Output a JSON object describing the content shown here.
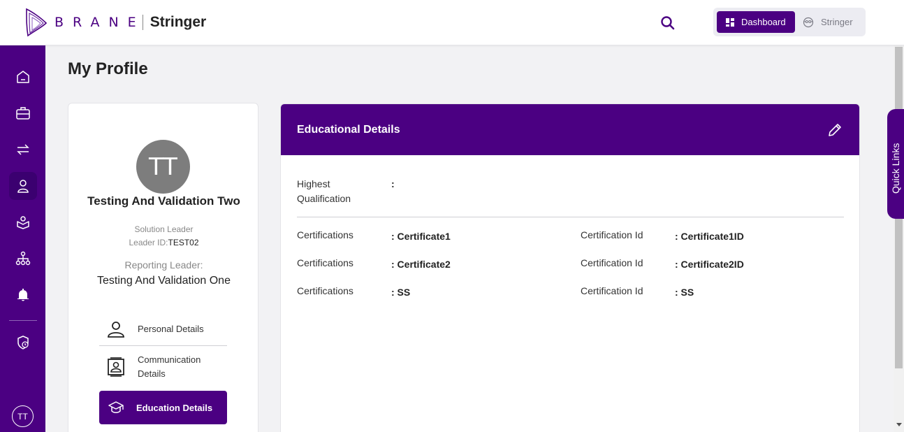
{
  "header": {
    "brand": "BRANE",
    "product": "Stringer",
    "switcher": {
      "dashboard_label": "Dashboard",
      "stringer_label": "Stringer"
    }
  },
  "sidebar": {
    "items": [
      {
        "icon": "home-icon"
      },
      {
        "icon": "briefcase-icon"
      },
      {
        "icon": "transfer-icon"
      },
      {
        "icon": "user-icon",
        "active": true
      },
      {
        "icon": "training-icon"
      },
      {
        "icon": "hierarchy-icon"
      },
      {
        "icon": "bell-icon"
      },
      {
        "icon": "security-icon"
      }
    ],
    "avatar_initials": "TT"
  },
  "page": {
    "title": "My Profile"
  },
  "profile": {
    "initials": "TT",
    "name": "Testing And Validation Two",
    "role": "Solution Leader",
    "leader_id_label": "Leader ID:",
    "leader_id": "TEST02",
    "reporting_label": "Reporting Leader:",
    "reporting_name": "Testing And Validation One",
    "menu": [
      {
        "label": "Personal Details"
      },
      {
        "label": "Communication Details"
      },
      {
        "label": "Education Details",
        "active": true
      }
    ]
  },
  "education": {
    "title": "Educational Details",
    "highest_label": "Highest Qualification",
    "highest_value": ":",
    "cert_label": "Certifications",
    "cert_id_label": "Certification Id",
    "certifications": [
      {
        "name": ": Certificate1",
        "id": ": Certificate1ID"
      },
      {
        "name": ": Certificate2",
        "id": ": Certificate2ID"
      },
      {
        "name": ": SS",
        "id": ": SS"
      }
    ]
  },
  "quick_links": {
    "label": "Quick Links"
  },
  "colors": {
    "brand": "#4b0082",
    "background": "#f2f2f4"
  }
}
